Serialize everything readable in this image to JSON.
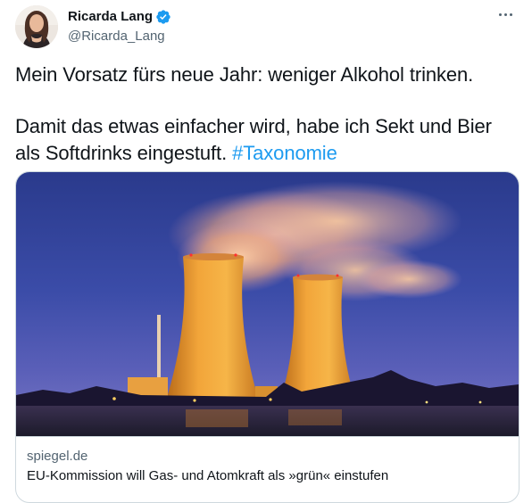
{
  "author": {
    "display_name": "Ricarda Lang",
    "handle": "@Ricarda_Lang",
    "verified": true,
    "verified_color": "#1d9bf0"
  },
  "tweet": {
    "line1": "Mein Vorsatz fürs neue Jahr: weniger Alkohol trinken.",
    "line2_text": "Damit das etwas einfacher wird, habe ich Sekt und Bier als Softdrinks eingestuft.",
    "hashtag": "#Taxonomie",
    "hashtag_color": "#1d9bf0"
  },
  "card": {
    "domain": "spiegel.de",
    "title": "EU-Kommission will Gas- und Atomkraft als »grün« einstufen",
    "image_subject": "cooling-towers-at-dusk"
  },
  "icons": {
    "verified": "verified-badge-icon",
    "more": "more-options-icon"
  }
}
